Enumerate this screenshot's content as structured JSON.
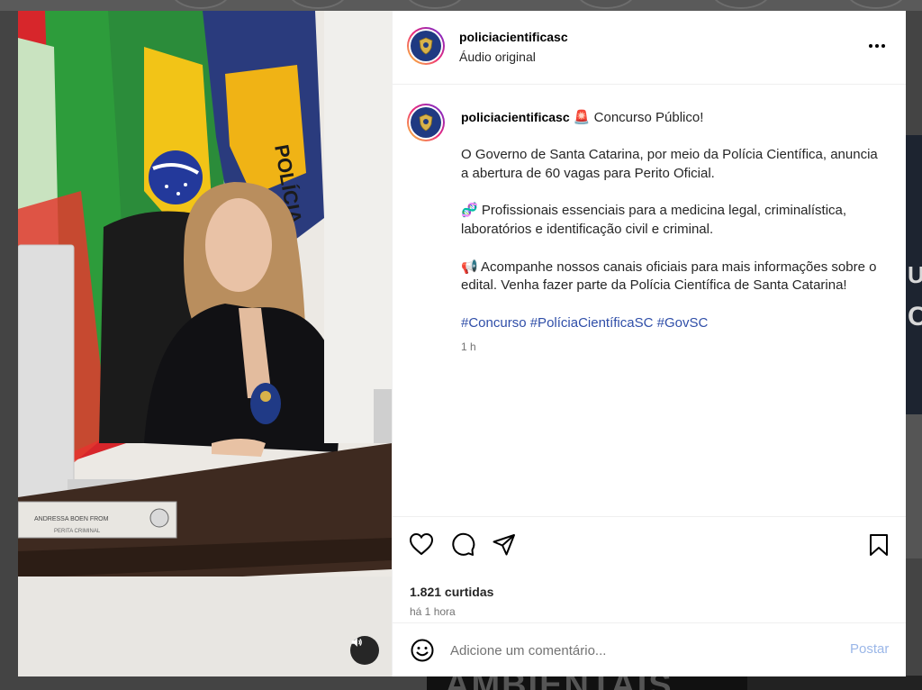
{
  "post": {
    "username": "policiacientificasc",
    "audio_label": "Áudio original",
    "caption": {
      "username": "policiacientificasc",
      "headline_emoji": "🚨",
      "headline": "Concurso Público!",
      "paragraph1": "O Governo de Santa Catarina, por meio da Polícia Científica, anuncia a abertura de 60 vagas para Perito Oficial.",
      "paragraph2_emoji": "🧬",
      "paragraph2": "Profissionais essenciais para a medicina legal, criminalística, laboratórios e identificação civil e criminal.",
      "paragraph3_emoji": "📢",
      "paragraph3": "Acompanhe nossos canais oficiais para mais informações sobre o edital. Venha fazer parte da Polícia Científica de Santa Catarina!",
      "hashtags": [
        "#Concurso",
        "#PolíciaCientíficaSC",
        "#GovSC"
      ],
      "time": "1 h"
    },
    "likes": "1.821 curtidas",
    "posted": "há 1 hora",
    "comment_placeholder": "Adicione um comentário...",
    "post_button": "Postar",
    "media": {
      "nameplate_name": "ANDRESSA BOEN FROM",
      "nameplate_title": "PERITA CRIMINAL",
      "flag_text": "POLÍCIA"
    }
  },
  "background": {
    "bottom_text": "AMBIENTAIS"
  },
  "colors": {
    "hashtag": "#2f4ea8",
    "post_button": "#9bb7e8",
    "badge": "#1f3a82"
  },
  "icons": {
    "more": "more-horizontal-icon",
    "like": "heart-icon",
    "comment": "comment-icon",
    "share": "share-icon",
    "save": "bookmark-icon",
    "emoji": "emoji-icon",
    "audio": "speaker-icon"
  }
}
